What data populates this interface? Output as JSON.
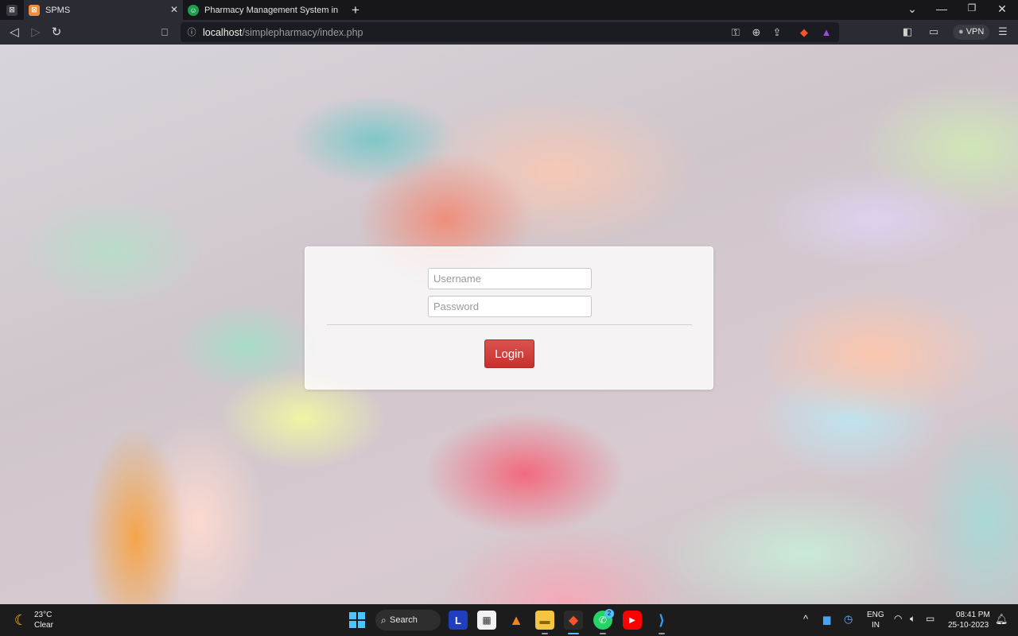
{
  "browser": {
    "tabs": [
      {
        "label": "SPMS",
        "active": true
      },
      {
        "label": "Pharmacy Management System in php",
        "active": false
      }
    ],
    "new_tab": "+",
    "address": {
      "host": "localhost",
      "path": "/simplepharmacy/index.php"
    },
    "vpn_label": "VPN",
    "colors": {
      "tab_active": "#2b2c33",
      "tab_bar": "#16161b"
    }
  },
  "login": {
    "username_placeholder": "Username",
    "password_placeholder": "Password",
    "button_label": "Login",
    "button_color": "#d9534f"
  },
  "taskbar": {
    "weather": {
      "temp": "23°C",
      "condition": "Clear"
    },
    "search_label": "Search",
    "pinned": [
      "windows-start",
      "search",
      "lens",
      "microsoft-store",
      "vlc",
      "file-explorer",
      "brave",
      "whatsapp",
      "youtube",
      "vs-code"
    ],
    "whatsapp_badge": "2",
    "language": {
      "line1": "ENG",
      "line2": "IN"
    },
    "clock": {
      "time": "08:41 PM",
      "date": "25-10-2023"
    }
  }
}
